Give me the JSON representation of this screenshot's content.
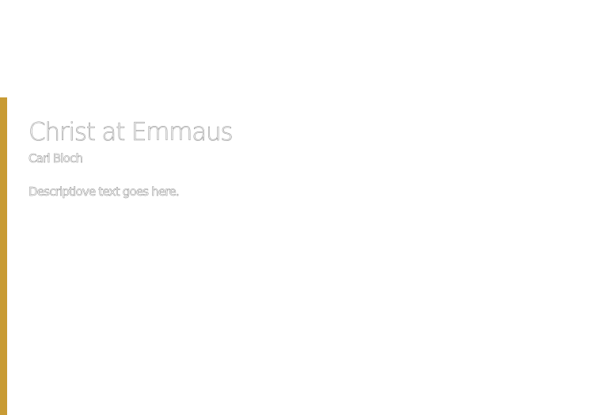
{
  "colors": {
    "accent": "#c89b34",
    "background": "#ffffff",
    "text_outline": "#9a9a9a"
  },
  "artwork": {
    "title": "Christ at Emmaus",
    "artist": "Carl Bloch",
    "description": "Descriptiove text goes here."
  }
}
